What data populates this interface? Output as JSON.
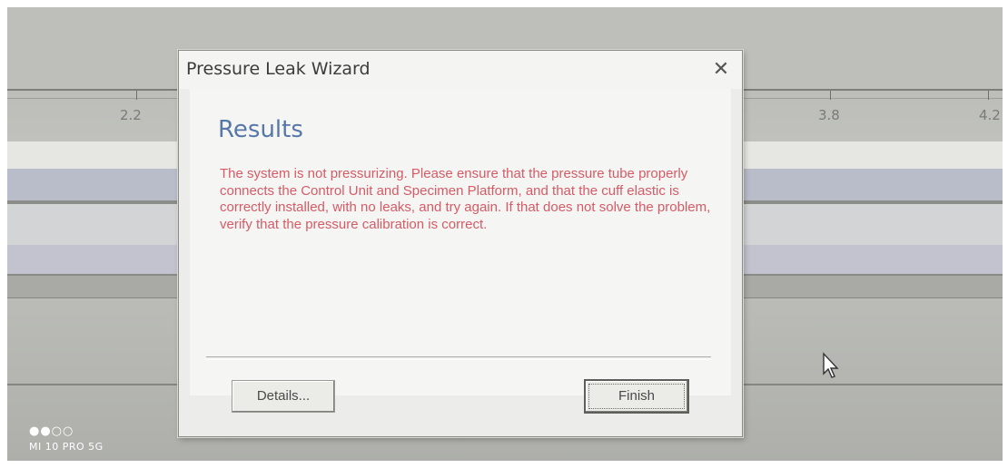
{
  "background": {
    "ruler_ticks": [
      "2.2",
      "3.8",
      "4.2"
    ]
  },
  "dialog": {
    "title": "Pressure Leak Wizard",
    "close_glyph": "✕",
    "heading": "Results",
    "message": "The system is not pressurizing. Please ensure that the pressure tube properly connects the Control Unit and Specimen Platform, and that the cuff elastic is correctly installed, with no leaks, and try again. If that does not solve the problem, verify that the pressure calibration is correct.",
    "buttons": {
      "details_label": "Details...",
      "finish_label": "Finish"
    }
  },
  "watermark": {
    "dots": "●●○○",
    "device": "MI 10 PRO 5G"
  },
  "colors": {
    "heading": "#5677a8",
    "message": "#d65b66",
    "dialog_bg": "#ececea"
  },
  "icons": {
    "close": "close-icon",
    "cursor": "mouse-pointer-icon"
  }
}
